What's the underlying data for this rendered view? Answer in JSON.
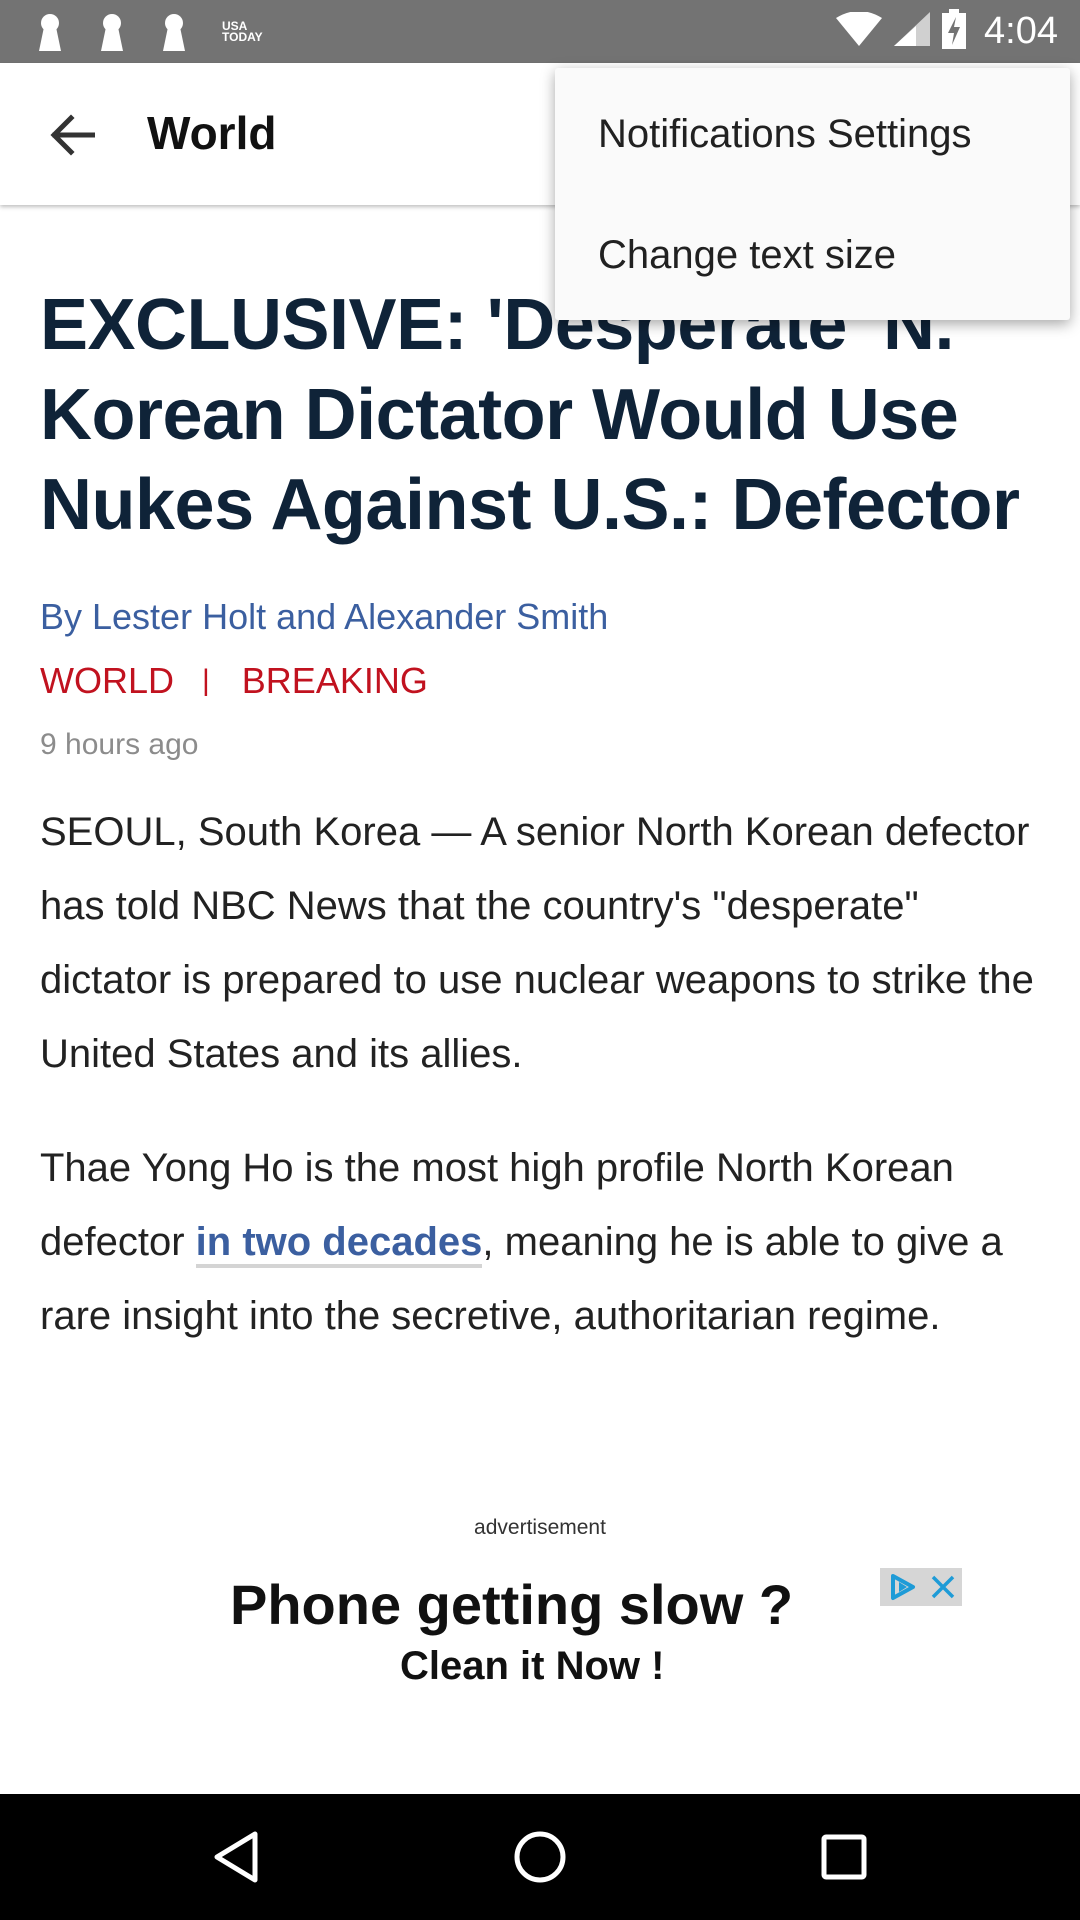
{
  "status_bar": {
    "time": "4:04",
    "app_logo_text": "USA TODAY",
    "icons": [
      "notification-keyhole-icon",
      "notification-keyhole-icon",
      "notification-keyhole-icon",
      "usa-today-logo",
      "wifi-icon",
      "cellular-signal-icon",
      "battery-charging-icon"
    ]
  },
  "app_bar": {
    "title": "World",
    "back_icon": "arrow-back-icon"
  },
  "menu": {
    "items": [
      {
        "label": "Notifications Settings"
      },
      {
        "label": "Change text size"
      }
    ]
  },
  "article": {
    "headline": "EXCLUSIVE: 'Desperate' N. Korean Dictator Would Use Nukes Against U.S.: Defector",
    "byline": "By Lester Holt and Alexander Smith",
    "tags": [
      "WORLD",
      "BREAKING"
    ],
    "tag_separator": "|",
    "timestamp": "9 hours ago",
    "paragraph1": "SEOUL, South Korea — A senior North Korean defector has told NBC News that the country's \"desperate\" dictator is prepared to use nuclear weapons to strike the United States and its allies.",
    "paragraph2_before": "Thae Yong Ho is the most high profile North Korean defector ",
    "paragraph2_link": "in two decades",
    "paragraph2_after": ", meaning he is able to give a rare insight into the secretive, authoritarian regime."
  },
  "ad": {
    "label": "advertisement",
    "headline": "Phone getting slow ?",
    "subline": "Clean it Now !"
  },
  "colors": {
    "status_bar": "#737373",
    "headline": "#0f2338",
    "byline": "#3b5fa0",
    "tag": "#c1121f",
    "timestamp": "#8c8c8c",
    "nav_bar": "#000000"
  },
  "nav_bar": {
    "icons": [
      "nav-back-icon",
      "nav-home-icon",
      "nav-recents-icon"
    ]
  }
}
